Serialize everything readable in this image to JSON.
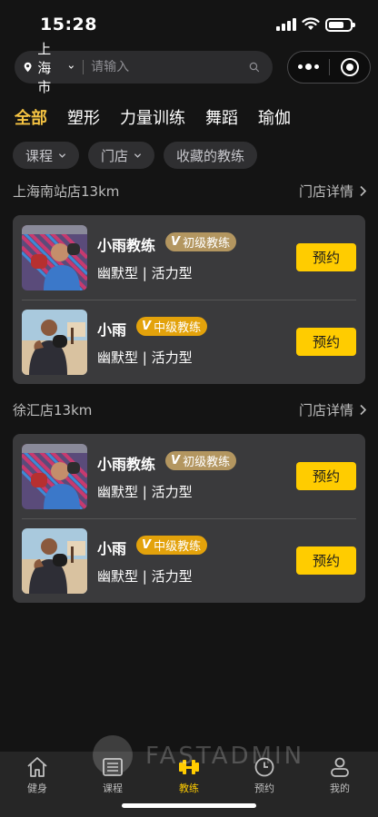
{
  "status": {
    "time": "15:28"
  },
  "search": {
    "city": "上海市",
    "placeholder": "请输入"
  },
  "categories": [
    {
      "label": "全部",
      "active": true
    },
    {
      "label": "塑形",
      "active": false
    },
    {
      "label": "力量训练",
      "active": false
    },
    {
      "label": "舞蹈",
      "active": false
    },
    {
      "label": "瑜伽",
      "active": false
    }
  ],
  "filters": [
    {
      "label": "课程",
      "dropdown": true
    },
    {
      "label": "门店",
      "dropdown": true
    },
    {
      "label": "收藏的教练",
      "dropdown": false
    }
  ],
  "stores": [
    {
      "name": "上海南站店13km",
      "detail_label": "门店详情",
      "coaches": [
        {
          "name": "小雨教练",
          "level": "初级教练",
          "level_type": "junior",
          "tags": "幽默型 | 活力型",
          "avatar": "boxer-icon",
          "book_label": "预约"
        },
        {
          "name": "小雨",
          "level": "中级教练",
          "level_type": "mid",
          "tags": "幽默型 | 活力型",
          "avatar": "beach-boxer-icon",
          "book_label": "预约"
        }
      ]
    },
    {
      "name": "徐汇店13km",
      "detail_label": "门店详情",
      "coaches": [
        {
          "name": "小雨教练",
          "level": "初级教练",
          "level_type": "junior",
          "tags": "幽默型 | 活力型",
          "avatar": "boxer-icon",
          "book_label": "预约"
        },
        {
          "name": "小雨",
          "level": "中级教练",
          "level_type": "mid",
          "tags": "幽默型 | 活力型",
          "avatar": "beach-boxer-icon",
          "book_label": "预约"
        }
      ]
    }
  ],
  "tabbar": [
    {
      "label": "健身",
      "icon": "home-icon",
      "active": false
    },
    {
      "label": "课程",
      "icon": "list-icon",
      "active": false
    },
    {
      "label": "教练",
      "icon": "dumbbell-icon",
      "active": true
    },
    {
      "label": "预约",
      "icon": "clock-icon",
      "active": false
    },
    {
      "label": "我的",
      "icon": "user-icon",
      "active": false
    }
  ],
  "watermark": "FASTADMIN",
  "colors": {
    "accent": "#ffcc00",
    "active_tab": "#f5c342",
    "badge_junior": "#b39660",
    "badge_mid": "#e3a20b",
    "card": "#3a3a3c",
    "background": "#141414"
  }
}
